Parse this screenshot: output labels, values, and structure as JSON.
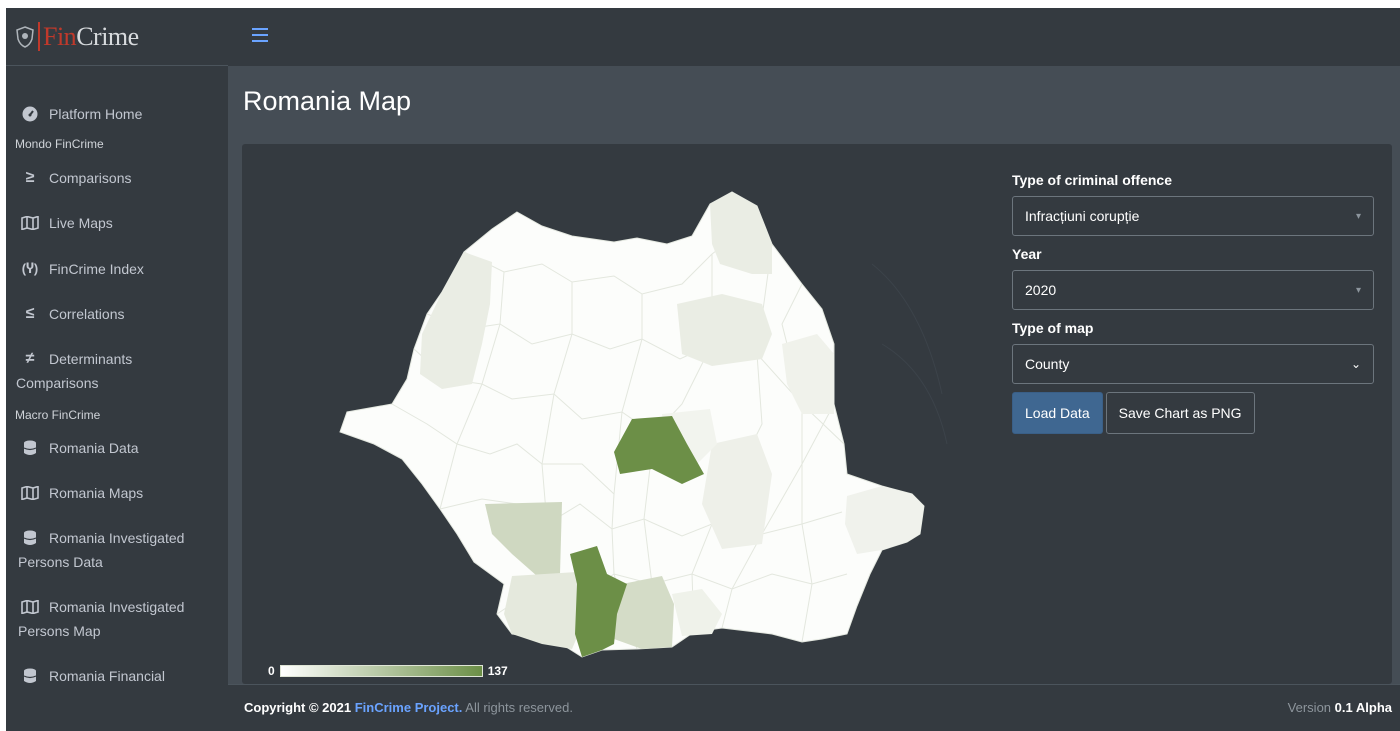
{
  "brand": {
    "fin": "Fin",
    "crime": "Crime"
  },
  "sidebar": {
    "items": [
      {
        "label": "Platform Home",
        "icon": "tachometer-icon"
      },
      {
        "header": "Mondo FinCrime"
      },
      {
        "label": "Comparisons",
        "icon": "greater-equal-icon"
      },
      {
        "label": "Live Maps",
        "icon": "map-icon"
      },
      {
        "label": "FinCrime Index",
        "icon": "broadcast-tower-icon"
      },
      {
        "label": "Correlations",
        "icon": "less-equal-icon"
      },
      {
        "label_line1": "Determinants",
        "label_line2": "Comparisons",
        "icon": "not-equal-icon"
      },
      {
        "header": "Macro FinCrime"
      },
      {
        "label": "Romania Data",
        "icon": "database-icon"
      },
      {
        "label": "Romania Maps",
        "icon": "map-icon"
      },
      {
        "label_line1": "Romania Investigated",
        "label_line2": "Persons Data",
        "icon": "database-icon"
      },
      {
        "label_line1": "Romania Investigated",
        "label_line2": "Persons Map",
        "icon": "map-icon"
      },
      {
        "label_line1": "Romania Financial",
        "icon": "database-icon"
      }
    ]
  },
  "page": {
    "title": "Romania Map"
  },
  "controls": {
    "offence_label": "Type of criminal offence",
    "offence_value": "Infracțiuni corupție",
    "year_label": "Year",
    "year_value": "2020",
    "maptype_label": "Type of map",
    "maptype_value": "County",
    "load_button": "Load Data",
    "save_button": "Save Chart as PNG"
  },
  "legend": {
    "min": "0",
    "max": "137"
  },
  "colors": {
    "low": "#ffffff",
    "high": "#6c8f47"
  },
  "footer": {
    "copyright_prefix": "Copyright © 2021",
    "project": "FinCrime Project.",
    "rights": "All rights reserved.",
    "version_label": "Version",
    "version_value": "0.1 Alpha"
  }
}
